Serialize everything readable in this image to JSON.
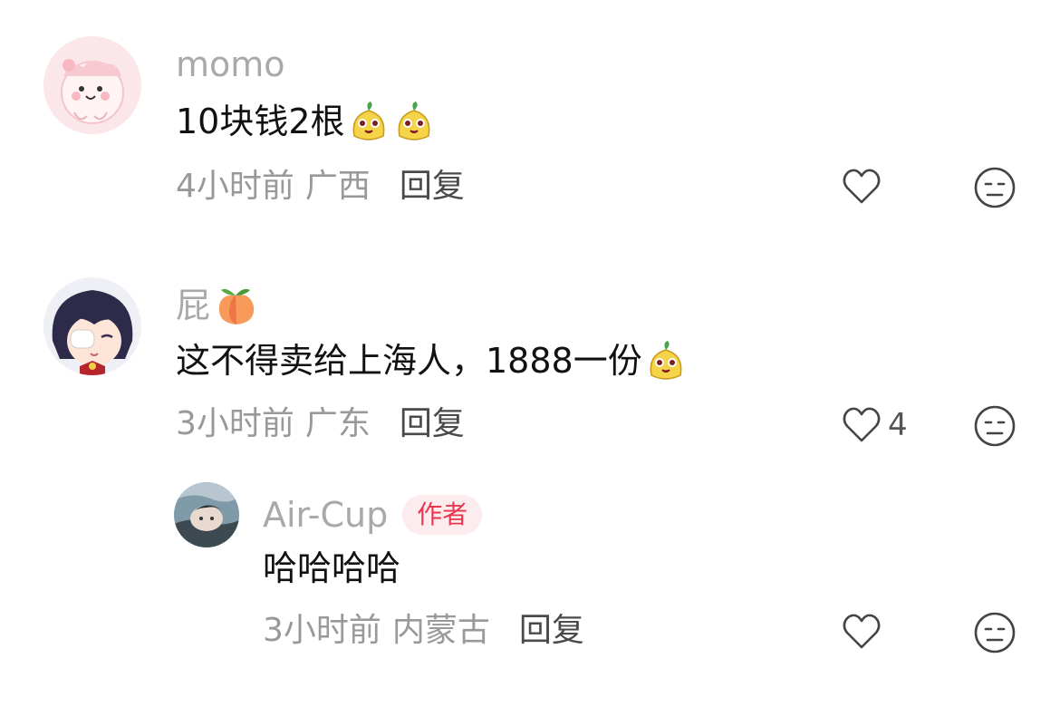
{
  "comments": [
    {
      "username": "momo",
      "content": "10块钱2根",
      "time": "4小时前",
      "location": "广西",
      "reply_label": "回复",
      "likes": ""
    },
    {
      "username": "屁",
      "content": "这不得卖给上海人，1888一份",
      "time": "3小时前",
      "location": "广东",
      "reply_label": "回复",
      "likes": "4"
    },
    {
      "username": "Air-Cup",
      "badge": "作者",
      "content": "哈哈哈哈",
      "time": "3小时前",
      "location": "内蒙古",
      "reply_label": "回复",
      "likes": ""
    }
  ],
  "colors": {
    "username": "#a9a9a9",
    "meta": "#999999",
    "reply": "#4a4a4a",
    "badge_bg": "#fdecee",
    "badge_text": "#e8364f"
  },
  "icons": {
    "like": "heart-outline-icon",
    "dislike": "neutral-face-icon",
    "sticker": "yellow-pear-sticker",
    "peach": "peach-emoji"
  }
}
